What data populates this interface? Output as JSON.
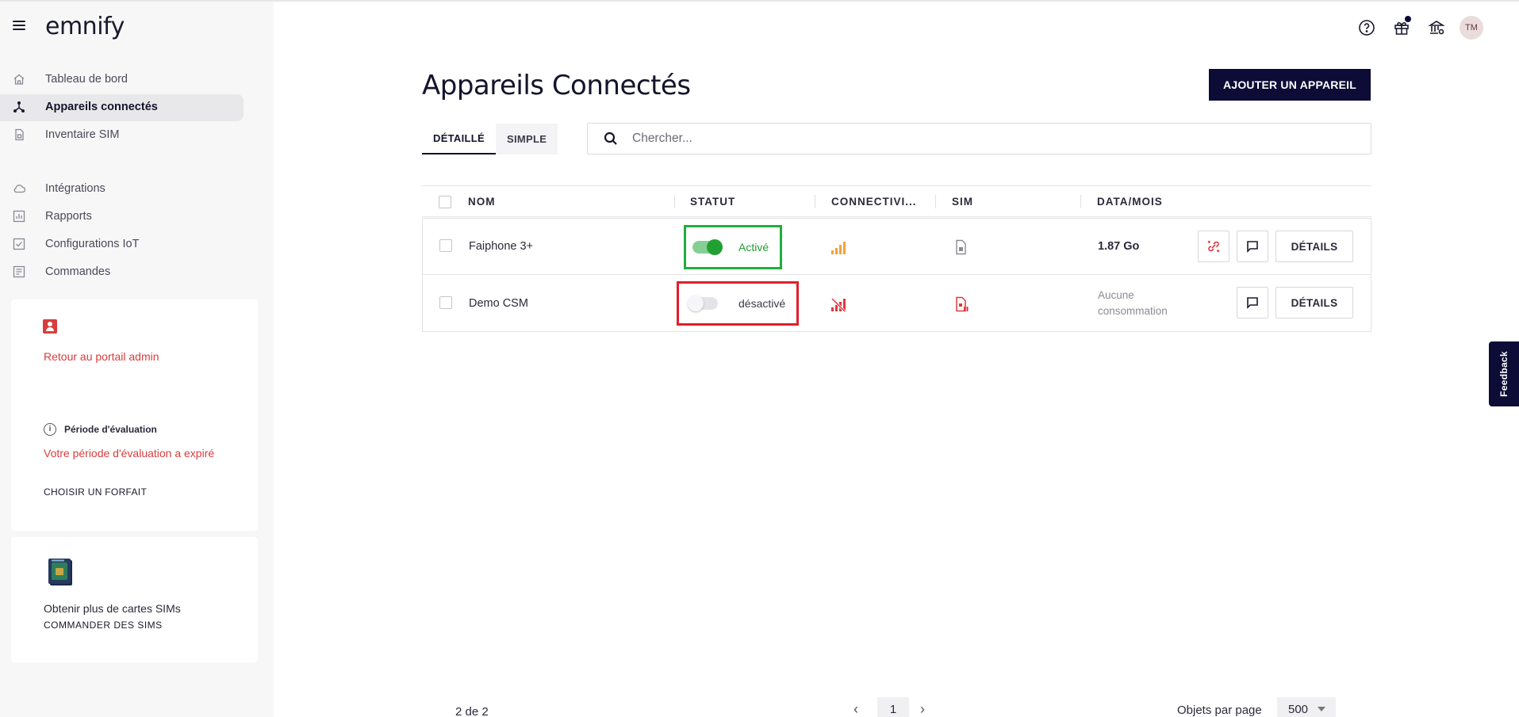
{
  "app": {
    "logo": "emnify"
  },
  "sidebar": {
    "items": [
      {
        "label": "Tableau de bord",
        "icon": "home-icon"
      },
      {
        "label": "Appareils connectés",
        "icon": "devices-icon",
        "active": true
      },
      {
        "label": "Inventaire SIM",
        "icon": "sim-icon"
      },
      {
        "label": "Intégrations",
        "icon": "cloud-icon"
      },
      {
        "label": "Rapports",
        "icon": "reports-icon"
      },
      {
        "label": "Configurations IoT",
        "icon": "checklist-icon"
      },
      {
        "label": "Commandes",
        "icon": "orders-icon"
      }
    ],
    "admin_card": {
      "link": "Retour au portail admin"
    },
    "trial_card": {
      "title": "Période d'évaluation",
      "message": "Votre période d'évaluation a expiré",
      "cta": "CHOISIR UN FORFAIT"
    },
    "sims_card": {
      "text": "Obtenir plus de cartes SIMs",
      "cta": "COMMANDER DES SIMS"
    }
  },
  "header": {
    "avatar_initials": "TM"
  },
  "main": {
    "title": "Appareils Connectés",
    "add_button": "AJOUTER UN APPAREIL",
    "tabs": [
      {
        "label": "DÉTAILLÉ",
        "active": true
      },
      {
        "label": "SIMPLE",
        "active": false
      }
    ],
    "search_placeholder": "Chercher...",
    "table": {
      "headers": {
        "name": "NOM",
        "status": "STATUT",
        "connectivity": "CONNECTIVI...",
        "sim": "SIM",
        "data": "DATA/MOIS"
      },
      "rows": [
        {
          "name": "Faiphone 3+",
          "status": "Activé",
          "enabled": true,
          "data": "1.87 Go",
          "details": "DÉTAILS"
        },
        {
          "name": "Demo CSM",
          "status": "désactivé",
          "enabled": false,
          "data": "Aucune consommation",
          "details": "DÉTAILS"
        }
      ]
    },
    "footer": {
      "count": "2 de 2",
      "page": "1",
      "per_page_label": "Objets par page",
      "per_page_value": "500"
    }
  },
  "feedback": "Feedback",
  "colors": {
    "brand_dark": "#0c0c36",
    "active_green": "#22a034",
    "error_red": "#d73d3d",
    "signal_orange": "#f5a23a"
  }
}
